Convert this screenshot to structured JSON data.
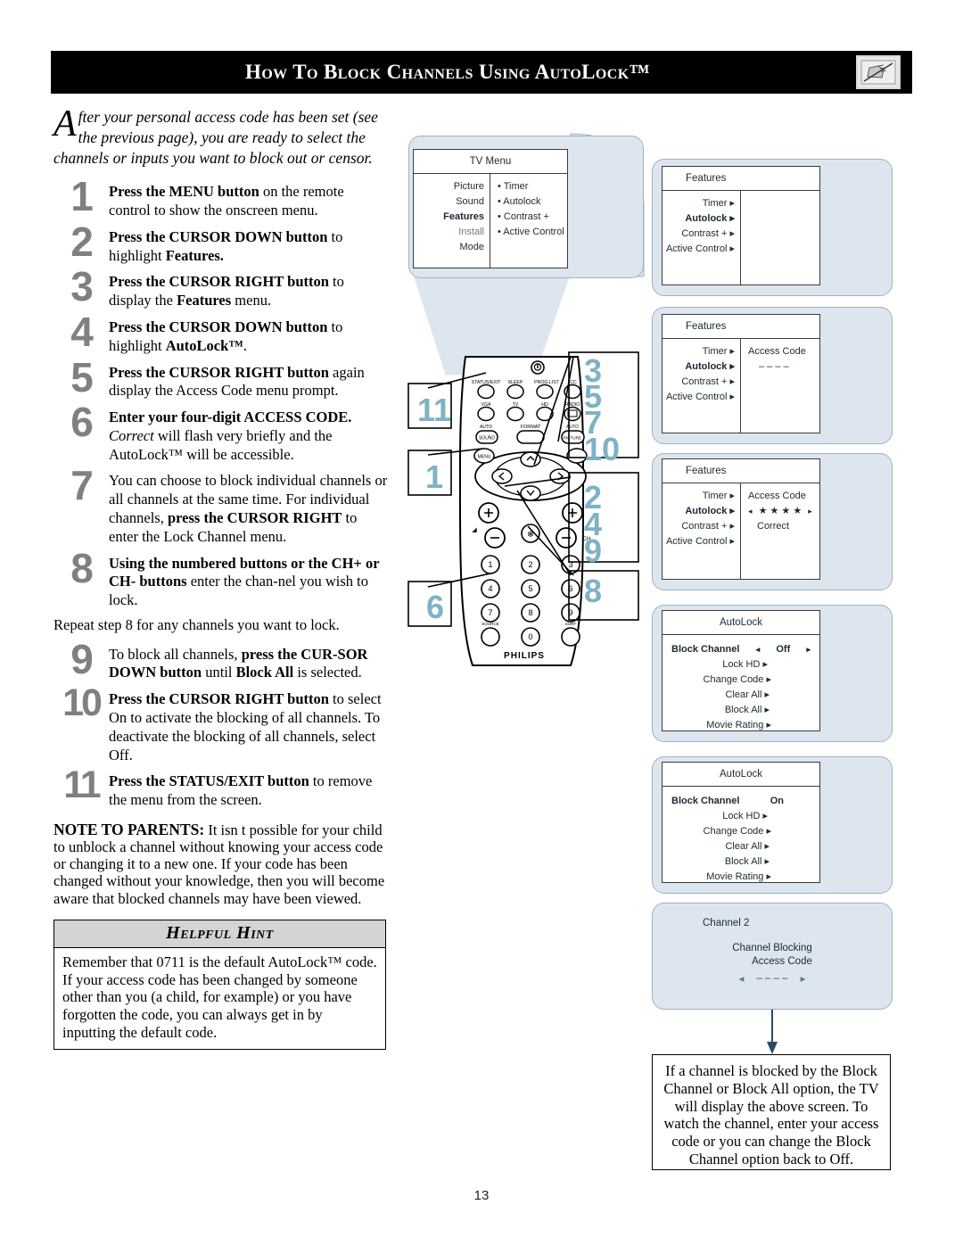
{
  "header": {
    "title": "How to Block Channels using AutoLock™",
    "icon": "tv-hand-icon"
  },
  "page_number": "13",
  "intro": {
    "dropcap": "A",
    "text": "fter your personal access code has been set (see the previous page), you are ready to select the channels or inputs you want to block out or censor."
  },
  "steps": [
    {
      "num": "1",
      "html": "<b>Press the MENU button</b> on the remote control to show the onscreen menu."
    },
    {
      "num": "2",
      "html": "<b>Press the CURSOR DOWN button</b> to highlight <b>Features.</b>"
    },
    {
      "num": "3",
      "html": "<b>Press the CURSOR RIGHT button</b> to display the <b>Features</b> menu."
    },
    {
      "num": "4",
      "html": "<b>Press the CURSOR DOWN button</b> to highlight <b>AutoLock™</b>."
    },
    {
      "num": "5",
      "html": "<b>Press the CURSOR RIGHT button</b> again display the Access Code menu prompt."
    },
    {
      "num": "6",
      "html": "<b>Enter your four-digit ACCESS CODE.</b> <i>Correct</i> will flash very briefly and the AutoLock™ will be accessible."
    },
    {
      "num": "7",
      "html": "You can choose to block individual channels or all channels at the same time. For individual channels, <b>press the CURSOR RIGHT</b> to enter the Lock Channel menu."
    },
    {
      "num": "8",
      "html": "<b>Using the numbered buttons or the CH+ or CH- buttons</b> enter the chan-nel you wish to lock."
    }
  ],
  "repeat_note": "Repeat step 8 for any channels you want to lock.",
  "steps2": [
    {
      "num": "9",
      "html": "To block all channels, <b>press the CUR-SOR DOWN button</b> until <b>Block All</b> is selected."
    },
    {
      "num": "10",
      "html": "<b>Press the CURSOR RIGHT button</b> to select On to activate the blocking of all channels. To deactivate the blocking of all channels, select Off."
    },
    {
      "num": "11",
      "html": "<b>Press the STATUS/EXIT button</b> to remove the menu from the screen."
    }
  ],
  "note_to_parents": {
    "label": "NOTE TO PARENTS:",
    "text": " It isn t possible for your child to unblock a channel without knowing your access code or changing it to a new one. If your code has been changed without your knowledge, then you will become aware that blocked channels may have been viewed."
  },
  "helpful_hint": {
    "title": "Helpful Hint",
    "body": "Remember that 0711 is the default AutoLock™ code.  If your access code has been changed by someone other than you (a child, for example) or you have forgotten the code, you can always get in by inputting the default code."
  },
  "osd_screens": {
    "tv_menu": {
      "title": "TV Menu",
      "left_items": [
        "Picture",
        "Sound",
        "Features",
        "Install",
        "Mode"
      ],
      "highlight": "Features",
      "right_items": [
        "• Timer",
        "• Autolock",
        "• Contrast +",
        "•  Active Control"
      ]
    },
    "features_1": {
      "title": "Features",
      "left_items": [
        "Timer ▸",
        "Autolock ▸",
        "Contrast + ▸",
        "Active Control ▸"
      ],
      "highlight": "Autolock ▸",
      "right_items": []
    },
    "features_2": {
      "title": "Features",
      "left_items": [
        "Timer ▸",
        "Autolock ▸",
        "Contrast + ▸",
        "Active Control ▸"
      ],
      "highlight": "Autolock ▸",
      "right_label": "Access Code",
      "right_value": "– – – –"
    },
    "features_3": {
      "title": "Features",
      "left_items": [
        "Timer ▸",
        "Autolock ▸",
        "Contrast + ▸",
        "Active Control ▸"
      ],
      "highlight": "Autolock ▸",
      "right_label": "Access Code",
      "right_value": "★ ★ ★ ★",
      "left_arrow": "◂",
      "right_arrow": "▸",
      "confirm": "Correct"
    },
    "autolock_off": {
      "title": "AutoLock",
      "first_label": "Block Channel",
      "left_arrow": "◂",
      "value": "Off",
      "right_arrow": "▸",
      "items": [
        "Lock HD ▸",
        "Change Code ▸",
        "Clear All ▸",
        "Block All ▸",
        "Movie Rating ▸"
      ]
    },
    "autolock_on": {
      "title": "AutoLock",
      "first_label": "Block Channel",
      "value": "On",
      "items": [
        "Lock HD ▸",
        "Change Code ▸",
        "Clear All ▸",
        "Block All ▸",
        "Movie Rating ▸"
      ]
    },
    "blocked_screen": {
      "channel": "Channel 2",
      "line1": "Channel Blocking",
      "line2": "Access Code",
      "left_arrow": "◂",
      "value": "– – – –",
      "right_arrow": "▸"
    }
  },
  "bottom_note": "If a channel is blocked by the Block Channel or Block All option, the TV will display the above screen. To watch the channel, enter your access code or you can change the Block Channel option back to Off.",
  "remote": {
    "brand": "PHILIPS",
    "button_labels": {
      "status_exit": "STATUS/EXIT",
      "sleep": "SLEEP",
      "prog_list": "PROG.LIST",
      "cc": "CC",
      "vga": "VGA",
      "tv": "TV",
      "hd": "HD",
      "radio": "RADIO",
      "auto_sound_top": "AUTO",
      "auto_sound": "SOUND",
      "format": "FORMAT",
      "auto_picture_top": "AUTO",
      "auto_picture": "PICTURE",
      "menu": "MENU",
      "source": "SOURCE",
      "surf": "SURF"
    },
    "keypad": [
      "1",
      "2",
      "3",
      "4",
      "5",
      "6",
      "7",
      "8",
      "9",
      "0"
    ],
    "callouts_left": [
      "11",
      "1",
      "6"
    ],
    "callouts_right_top": [
      "3",
      "5",
      "7",
      "10"
    ],
    "callouts_right_mid": [
      "2",
      "4",
      "9"
    ],
    "callouts_right_bottom": [
      "8"
    ],
    "accent_color": "#7fb2c4"
  }
}
